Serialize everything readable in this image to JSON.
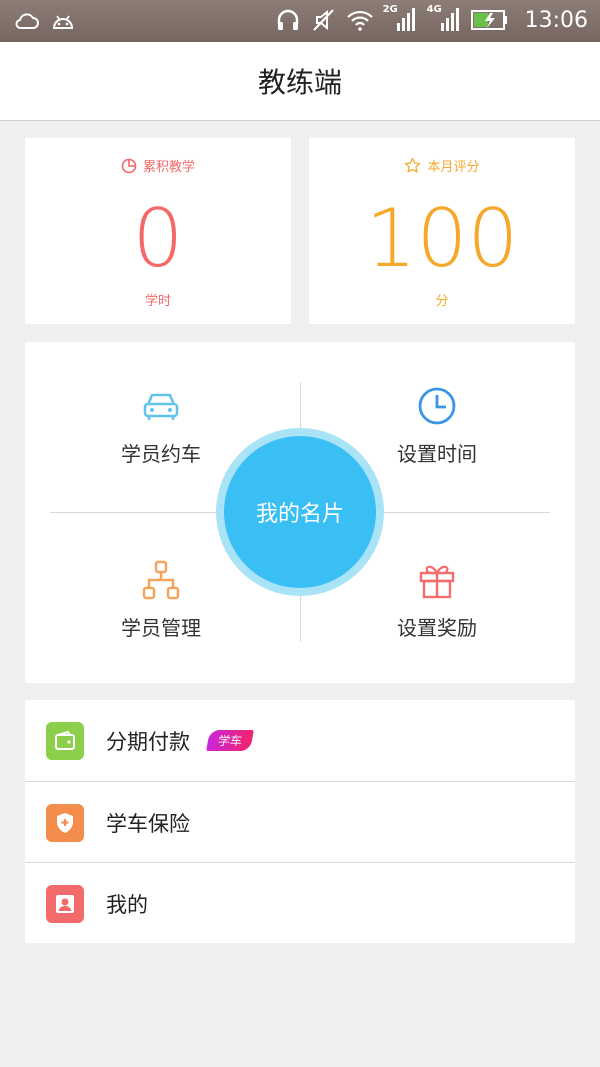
{
  "status_bar": {
    "time": "13:06",
    "network_2g": "2G",
    "network_4g": "4G",
    "icons": [
      "cloud-icon",
      "android-icon",
      "headphones-icon",
      "mute-icon",
      "wifi-icon",
      "signal-2g-icon",
      "signal-4g-icon",
      "battery-charging-icon"
    ]
  },
  "header": {
    "title": "教练端"
  },
  "stats": {
    "accumulated": {
      "label": "累积教学",
      "value": "0",
      "unit": "学时",
      "icon": "pie-chart-icon",
      "color": "#f46868"
    },
    "monthly": {
      "label": "本月评分",
      "value": "100",
      "unit": "分",
      "icon": "star-icon",
      "color": "#f4a92a"
    }
  },
  "panel": {
    "center_label": "我的名片",
    "items": [
      {
        "label": "学员约车",
        "icon": "car-icon",
        "color": "#62c4ea"
      },
      {
        "label": "设置时间",
        "icon": "clock-icon",
        "color": "#3b94e6"
      },
      {
        "label": "学员管理",
        "icon": "org-chart-icon",
        "color": "#f4a45c"
      },
      {
        "label": "设置奖励",
        "icon": "gift-icon",
        "color": "#f36d6d"
      }
    ]
  },
  "menu": [
    {
      "label": "分期付款",
      "badge": "学车",
      "icon": "wallet-icon",
      "color": "#8bcf4a"
    },
    {
      "label": "学车保险",
      "icon": "shield-plus-icon",
      "color": "#f48c4c"
    },
    {
      "label": "我的",
      "icon": "person-icon",
      "color": "#f36a6a"
    }
  ]
}
